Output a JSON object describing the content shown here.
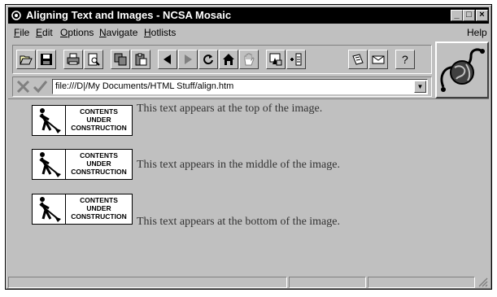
{
  "window": {
    "title": "Aligning Text and Images - NCSA Mosaic",
    "min_glyph": "_",
    "max_glyph": "□",
    "close_glyph": "×"
  },
  "menubar": {
    "items": [
      {
        "label": "File",
        "key": "F"
      },
      {
        "label": "Edit",
        "key": "E"
      },
      {
        "label": "Options",
        "key": "O"
      },
      {
        "label": "Navigate",
        "key": "N"
      },
      {
        "label": "Hotlists",
        "key": "H"
      }
    ],
    "help": "Help"
  },
  "toolbar": {
    "buttons": [
      "open-icon",
      "save-icon",
      "print-icon",
      "print-preview-icon",
      "copy-icon",
      "paste-icon",
      "back-icon",
      "forward-icon",
      "reload-icon",
      "home-icon",
      "stop-hand-icon",
      "add-hotlist-icon",
      "hotlist-icon",
      "annotate-icon",
      "mail-icon",
      "help-icon"
    ]
  },
  "url": {
    "value": "file:///D|/My Documents/HTML Stuff/align.htm"
  },
  "content": {
    "image_text": [
      "CONTENTS",
      "UNDER",
      "CONSTRUCTION"
    ],
    "lines": [
      "This text appears at the top of the image.",
      "This text appears in the middle of the image.",
      "This text appears at the bottom of the image."
    ]
  },
  "colors": {
    "chrome": "#c0c0c0",
    "titlebar": "#000000",
    "text": "#333333"
  }
}
